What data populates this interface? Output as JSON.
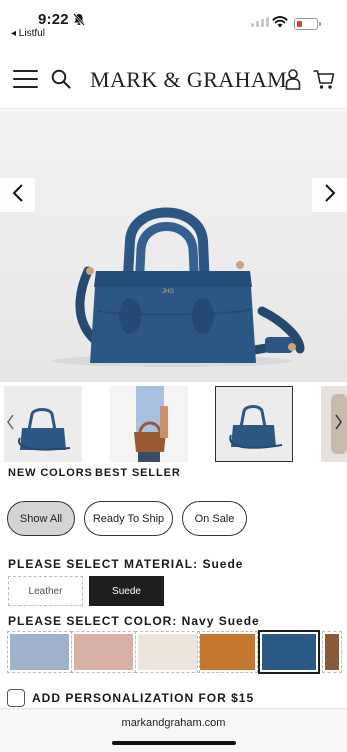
{
  "status_bar": {
    "time": "9:22",
    "back_app": "◂ Listful",
    "icons": [
      "silent-bell-icon",
      "cellular-signal-icon",
      "wifi-icon",
      "battery-icon"
    ],
    "battery_color": "#e23c34"
  },
  "header": {
    "brand": "MARK & GRAHAM",
    "icons": [
      "hamburger-menu-icon",
      "search-icon",
      "account-icon",
      "cart-icon"
    ]
  },
  "product": {
    "bag_color": "#2c5683",
    "hardware_color": "#c9a47e",
    "monogram": "JHG"
  },
  "badges": {
    "new_colors": "NEW COLORS",
    "best_seller": "BEST SELLER"
  },
  "filters": {
    "show_all": "Show All",
    "ready_to_ship": "Ready To Ship",
    "on_sale": "On Sale"
  },
  "material": {
    "label": "PLEASE SELECT MATERIAL: Suede",
    "options": [
      "Leather",
      "Suede"
    ],
    "selected": "Suede"
  },
  "color": {
    "label": "PLEASE SELECT COLOR: Navy Suede",
    "swatches": [
      {
        "color": "#9fb1cb"
      },
      {
        "color": "#d8b0a6"
      },
      {
        "color": "#ede6dc"
      },
      {
        "color": "#c5772d"
      },
      {
        "color": "#2d5986"
      },
      {
        "color": "#8a5a3a"
      }
    ],
    "selected_index": 4
  },
  "personalization": {
    "label": "ADD PERSONALIZATION FOR $15"
  },
  "browser": {
    "url": "markandgraham.com"
  }
}
